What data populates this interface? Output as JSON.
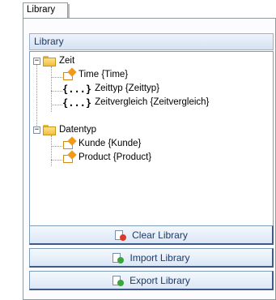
{
  "tab": {
    "label": "Library"
  },
  "section": {
    "title": "Library"
  },
  "tree": {
    "nodes": [
      {
        "label": "Zeit",
        "icon": "folder-icon",
        "expander": "−"
      },
      {
        "label": "Time {Time}",
        "icon": "object-icon"
      },
      {
        "label": "Zeittyp {Zeittyp}",
        "icon": "brace-icon",
        "glyph": "{...}"
      },
      {
        "label": "Zeitvergleich {Zeitvergleich}",
        "icon": "brace-icon",
        "glyph": "{...}"
      },
      {
        "label": "Datentyp",
        "icon": "folder-icon",
        "expander": "−"
      },
      {
        "label": "Kunde {Kunde}",
        "icon": "object-icon"
      },
      {
        "label": "Product {Product}",
        "icon": "object-icon"
      }
    ]
  },
  "buttons": {
    "clear": {
      "label": "Clear Library",
      "icon": "clear-library-icon",
      "color": "#d93a2b"
    },
    "import": {
      "label": "Import Library",
      "icon": "import-library-icon",
      "color": "#3aa63a"
    },
    "export": {
      "label": "Export Library",
      "icon": "export-library-icon",
      "color": "#3aa63a"
    }
  }
}
